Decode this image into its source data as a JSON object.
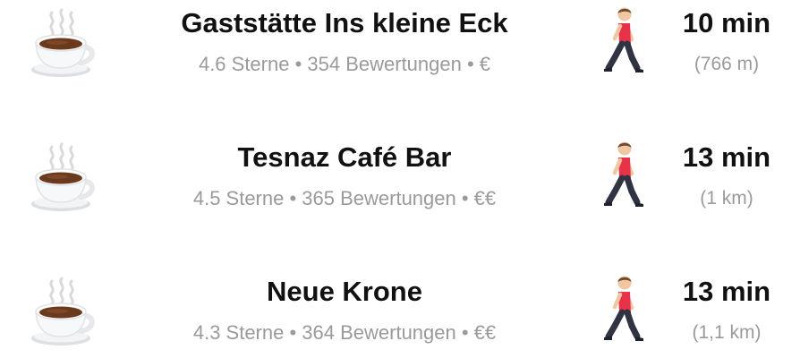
{
  "places": [
    {
      "name": "Gaststätte Ins kleine Eck",
      "meta": "4.6 Sterne • 354 Bewertungen • €",
      "time": "10 min",
      "distance": "(766 m)",
      "category_icon": "coffee-cup-icon",
      "travel_icon": "walking-person-icon"
    },
    {
      "name": "Tesnaz Café Bar",
      "meta": "4.5 Sterne • 365 Bewertungen • €€",
      "time": "13 min",
      "distance": "(1 km)",
      "category_icon": "coffee-cup-icon",
      "travel_icon": "walking-person-icon"
    },
    {
      "name": "Neue Krone",
      "meta": "4.3 Sterne • 364 Bewertungen • €€",
      "time": "13 min",
      "distance": "(1,1 km)",
      "category_icon": "coffee-cup-icon",
      "travel_icon": "walking-person-icon"
    }
  ],
  "colors": {
    "title": "#111111",
    "secondary": "#9a9a9a",
    "shirt": "#e8324a",
    "pants": "#2f3342",
    "coffee": "#6b3a1e"
  }
}
